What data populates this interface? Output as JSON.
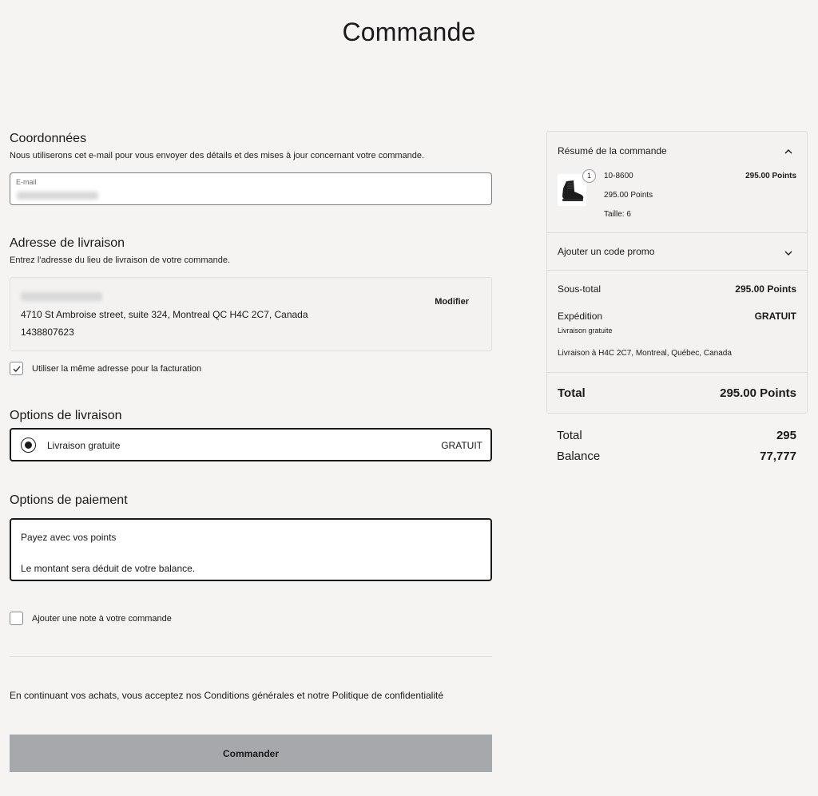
{
  "page": {
    "title": "Commande"
  },
  "contact": {
    "title": "Coordonnées",
    "subtitle": "Nous utiliserons cet e-mail pour vous envoyer des détails et des mises à jour concernant votre commande.",
    "email_label": "E-mail"
  },
  "shipping_address": {
    "title": "Adresse de livraison",
    "subtitle": "Entrez l'adresse du lieu de livraison de votre commande.",
    "address_line": "4710 St Ambroise street, suite 324, Montreal QC H4C 2C7, Canada",
    "phone": "1438807623",
    "modify_label": "Modifier",
    "same_billing_label": "Utiliser la même adresse pour la facturation"
  },
  "shipping_options": {
    "title": "Options de livraison",
    "option_name": "Livraison gratuite",
    "option_price": "GRATUIT"
  },
  "payment": {
    "title": "Options de paiement",
    "line1": "Payez avec vos points",
    "line2": "Le montant sera déduit de votre balance."
  },
  "note": {
    "label": "Ajouter une note à votre commande"
  },
  "terms": "En continuant vos achats, vous acceptez nos Conditions générales et notre Politique de confidentialité",
  "order_button": "Commander",
  "summary": {
    "title": "Résumé de la commande",
    "item": {
      "quantity": "1",
      "sku": "10-8600",
      "unit_price": "295.00 Points",
      "size": "Taille: 6",
      "price": "295.00 Points"
    },
    "promo_label": "Ajouter un code promo",
    "subtotal_label": "Sous-total",
    "subtotal_value": "295.00 Points",
    "shipping_label": "Expédition",
    "shipping_value": "GRATUIT",
    "shipping_method": "Livraison gratuite",
    "shipping_destination": "Livraison à H4C 2C7, Montreal, Québec, Canada",
    "total_label": "Total",
    "total_value": "295.00 Points"
  },
  "balance": {
    "total_label": "Total",
    "total_value": "295",
    "balance_label": "Balance",
    "balance_value": "77,777"
  }
}
